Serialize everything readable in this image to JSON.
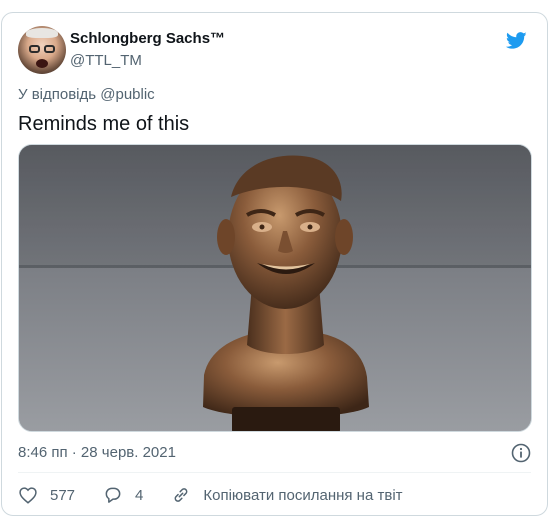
{
  "author": {
    "display_name": "Schlongberg Sachs™",
    "handle": "@TTL_TM"
  },
  "reply": {
    "prefix": "У відповідь",
    "mention": "@public"
  },
  "tweet": {
    "text": "Reminds me of this",
    "timestamp": "8:46 пп · 28 черв. 2021"
  },
  "actions": {
    "like_count": "577",
    "reply_count": "4",
    "copy_link_label": "Копіювати посилання на твіт"
  },
  "colors": {
    "twitter_blue": "#1d9bf0",
    "secondary_text": "#536471",
    "border": "#cfd9de"
  },
  "icons": [
    "twitter-bird-icon",
    "info-icon",
    "heart-icon",
    "reply-bubble-icon",
    "link-icon"
  ]
}
